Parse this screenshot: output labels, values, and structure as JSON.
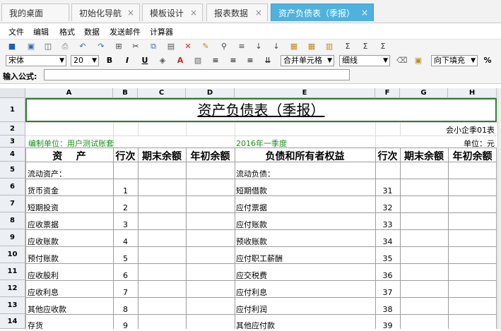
{
  "tabs": [
    {
      "label": "我的桌面",
      "closable": false,
      "active": false
    },
    {
      "label": "初始化导航",
      "closable": true,
      "active": false
    },
    {
      "label": "模板设计",
      "closable": true,
      "active": false
    },
    {
      "label": "报表数据",
      "closable": true,
      "active": false
    },
    {
      "label": "资产负债表（季报）",
      "closable": true,
      "active": true
    }
  ],
  "menu": [
    "文件",
    "编辑",
    "格式",
    "数据",
    "发送邮件",
    "计算器"
  ],
  "toolbar": {
    "font_name": "宋体",
    "font_size": "20",
    "bold": "B",
    "italic": "I",
    "underline": "U",
    "merge": "合并单元格",
    "border_style": "细线",
    "fill": "向下填充",
    "percent": "%"
  },
  "formula": {
    "label": "输入公式:",
    "value": ""
  },
  "columns": [
    "A",
    "B",
    "C",
    "D",
    "E",
    "F",
    "G",
    "H"
  ],
  "rows": [
    "1",
    "2",
    "3",
    "4",
    "5",
    "6",
    "7",
    "8",
    "9",
    "10",
    "11",
    "12",
    "13",
    "14"
  ],
  "sheet": {
    "title": "资产负债表（季报）",
    "form_code": "会小企季01表",
    "unit_label": "编制单位：用户测试账套",
    "period": "2016年一季度",
    "currency": "单位：元",
    "headers": {
      "asset": "资    产",
      "line_no": "行次",
      "end_balance": "期末余额",
      "begin_balance": "年初余额",
      "liability": "负债和所有者权益",
      "line_no2": "行次",
      "end_balance2": "期末余额",
      "begin_balance2": "年初余额"
    },
    "body": [
      {
        "asset": "流动资产：",
        "no": "",
        "liab": "流动负债：",
        "no2": ""
      },
      {
        "asset": "货币资金",
        "no": "1",
        "liab": "短期借款",
        "no2": "31"
      },
      {
        "asset": "短期投资",
        "no": "2",
        "liab": "应付票据",
        "no2": "32"
      },
      {
        "asset": "应收票据",
        "no": "3",
        "liab": "应付账款",
        "no2": "33"
      },
      {
        "asset": "应收账款",
        "no": "4",
        "liab": "预收账款",
        "no2": "34"
      },
      {
        "asset": "预付账款",
        "no": "5",
        "liab": "应付职工薪酬",
        "no2": "35"
      },
      {
        "asset": "应收股利",
        "no": "6",
        "liab": "应交税费",
        "no2": "36"
      },
      {
        "asset": "应收利息",
        "no": "7",
        "liab": "应付利息",
        "no2": "37"
      },
      {
        "asset": "其他应收款",
        "no": "8",
        "liab": "应付利润",
        "no2": "38"
      },
      {
        "asset": "存货",
        "no": "9",
        "liab": "其他应付款",
        "no2": "39"
      }
    ]
  },
  "colors": {
    "accent": "#4fb2de",
    "green_text": "#1a8f1a",
    "selection_border": "#2e7d32"
  }
}
